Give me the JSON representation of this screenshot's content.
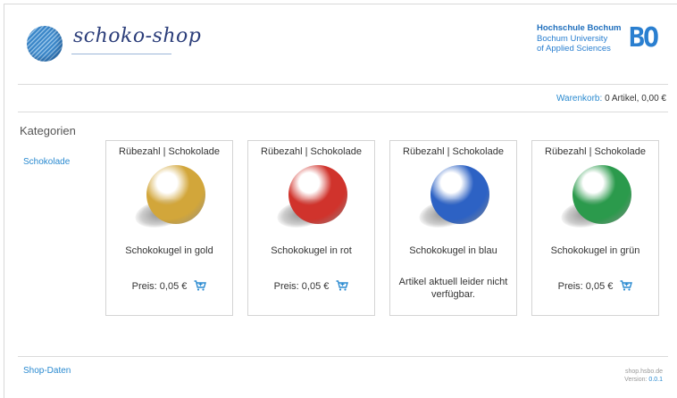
{
  "header": {
    "logo_text": "schoko-shop",
    "university_line1": "Hochschule Bochum",
    "university_line2": "Bochum University",
    "university_line3": "of Applied Sciences",
    "university_mark": "BO"
  },
  "cart": {
    "link_label": "Warenkorb:",
    "info": "0 Artikel, 0,00 €"
  },
  "sidebar": {
    "heading": "Kategorien",
    "items": [
      {
        "label": "Schokolade"
      }
    ]
  },
  "products": [
    {
      "maker": "Rübezahl | Schokolade",
      "name": "Schokokugel in gold",
      "price": "Preis: 0,05 €",
      "color": "#d2a63a",
      "available": true
    },
    {
      "maker": "Rübezahl | Schokolade",
      "name": "Schokokugel in rot",
      "price": "Preis: 0,05 €",
      "color": "#d0332c",
      "available": true
    },
    {
      "maker": "Rübezahl | Schokolade",
      "name": "Schokokugel in blau",
      "unavailable_text": "Artikel aktuell leider nicht verfügbar.",
      "color": "#2d62c4",
      "available": false
    },
    {
      "maker": "Rübezahl | Schokolade",
      "name": "Schokokugel in grün",
      "price": "Preis: 0,05 €",
      "color": "#2b9a4c",
      "available": true
    }
  ],
  "footer": {
    "link_label": "Shop-Daten",
    "domain": "shop.hsbo.de",
    "version_label": "Version:",
    "version": "0.0.1"
  }
}
